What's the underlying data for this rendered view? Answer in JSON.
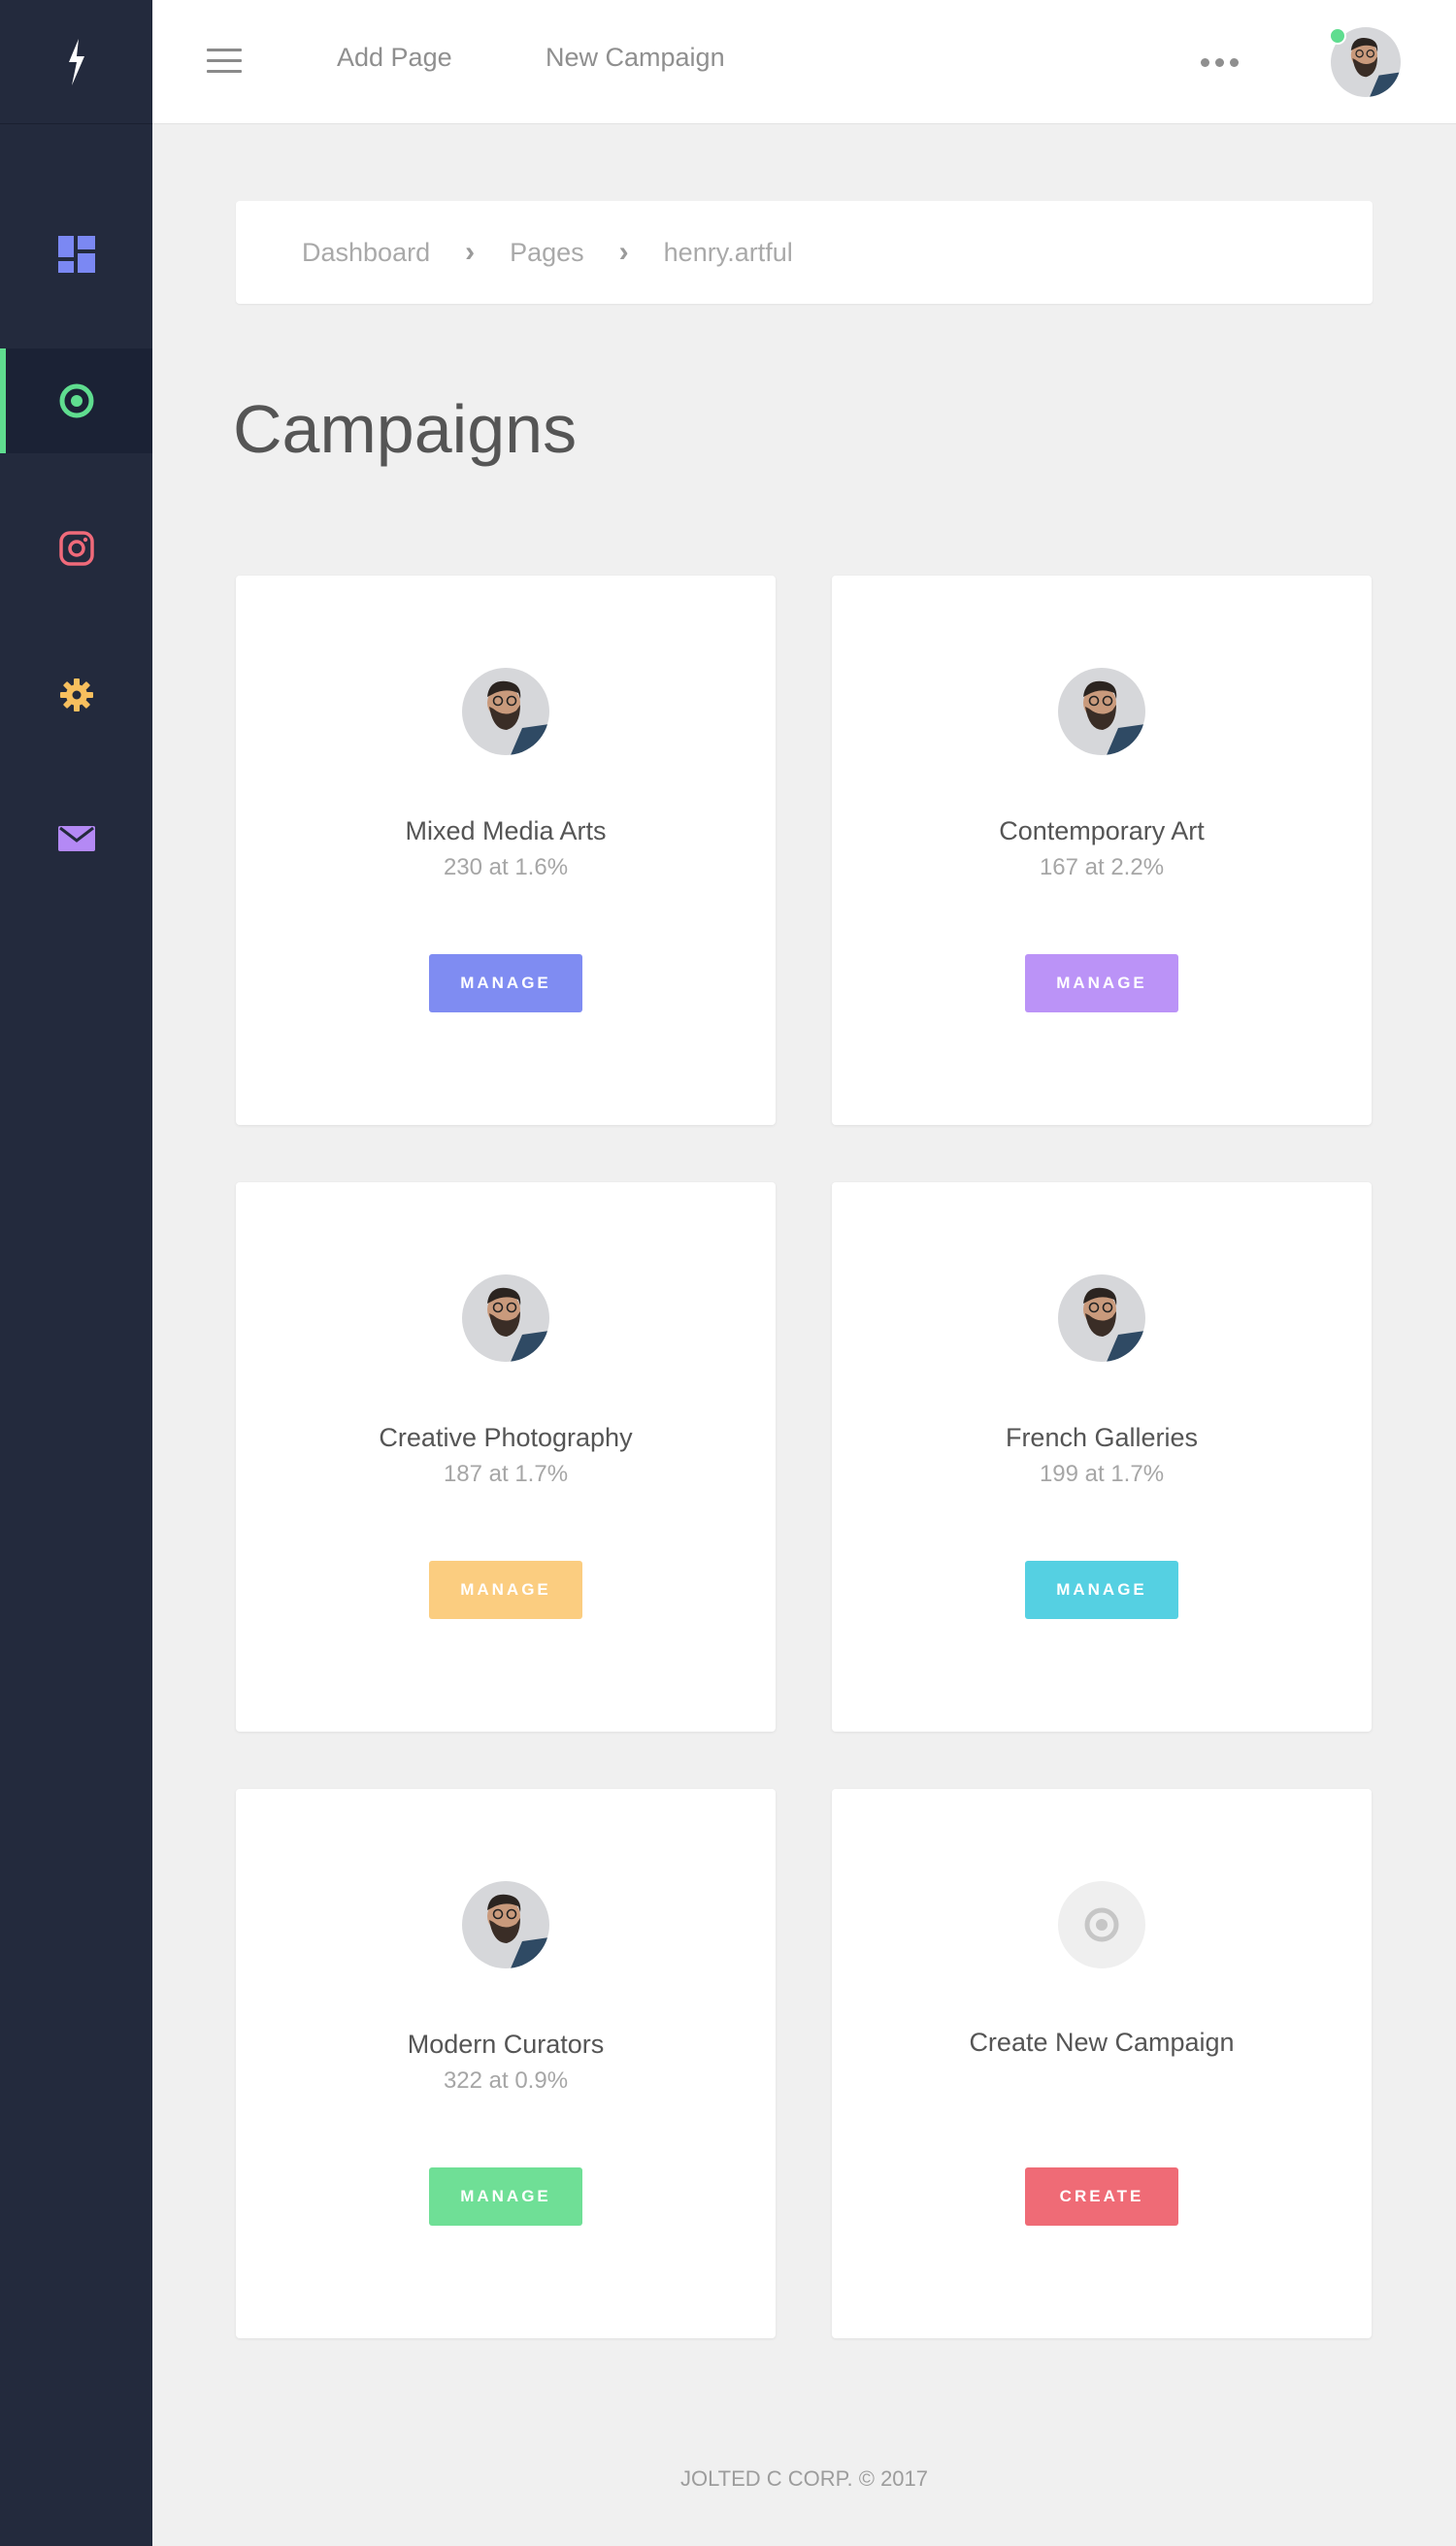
{
  "sidebar": {
    "logo_icon": "bolt-icon",
    "items": [
      {
        "icon": "dashboard-icon",
        "color": "#7b88f3",
        "active": false
      },
      {
        "icon": "target-icon",
        "color": "#5fdd8f",
        "active": true
      },
      {
        "icon": "instagram-icon",
        "color": "#f06a7a",
        "active": false
      },
      {
        "icon": "gear-icon",
        "color": "#f7bf5e",
        "active": false
      },
      {
        "icon": "mail-icon",
        "color": "#b489f5",
        "active": false
      }
    ]
  },
  "topbar": {
    "menu_icon": "hamburger-icon",
    "links": [
      "Add Page",
      "New Campaign"
    ],
    "more_icon": "more-dots-icon",
    "avatar_status": "online"
  },
  "breadcrumb": [
    "Dashboard",
    "Pages",
    "henry.artful"
  ],
  "breadcrumb_separator": "›",
  "page_title": "Campaigns",
  "campaigns": [
    {
      "name": "Mixed Media Arts",
      "stat": "230 at 1.6%",
      "button": "MANAGE",
      "color": "#7f8cf2"
    },
    {
      "name": "Contemporary Art",
      "stat": "167 at 2.2%",
      "button": "MANAGE",
      "color": "#bb93f7"
    },
    {
      "name": "Creative Photography",
      "stat": "187 at 1.7%",
      "button": "MANAGE",
      "color": "#fbcd80"
    },
    {
      "name": "French Galleries",
      "stat": "199 at 1.7%",
      "button": "MANAGE",
      "color": "#55d0e2"
    },
    {
      "name": "Modern Curators",
      "stat": "322  at 0.9%",
      "button": "MANAGE",
      "color": "#6fdf96"
    }
  ],
  "create_card": {
    "name": "Create New Campaign",
    "button": "CREATE",
    "color": "#ef6b76",
    "icon": "target-icon"
  },
  "footer": "JOLTED C CORP. © 2017"
}
